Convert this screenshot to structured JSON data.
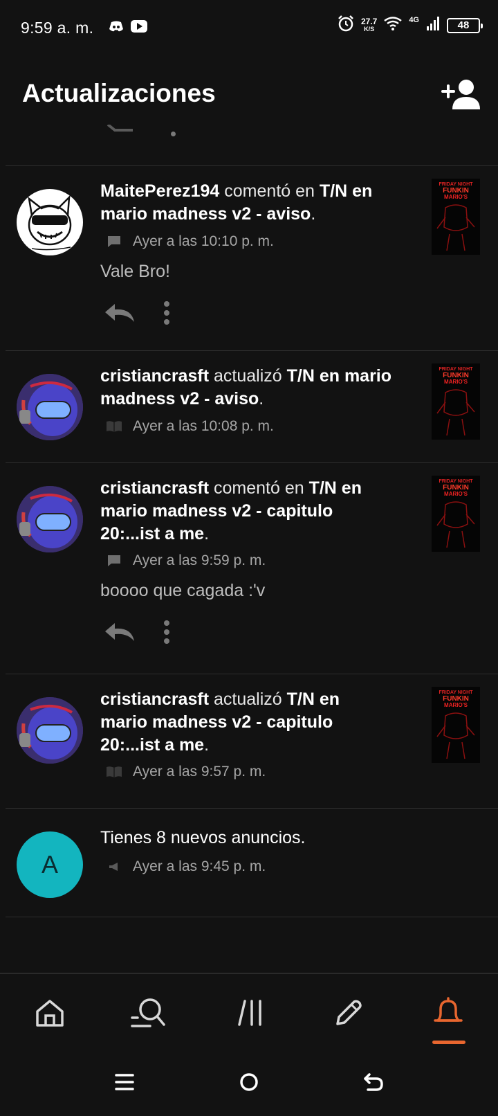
{
  "status_bar": {
    "time": "9:59 a. m.",
    "speed_value": "27.7",
    "speed_unit": "K/S",
    "network": "4G",
    "battery": "48"
  },
  "header": {
    "title": "Actualizaciones"
  },
  "notifications": [
    {
      "user": "MaitePerez194",
      "action": "comentó en",
      "story": "T/N en mario madness v2 - aviso",
      "suffix": ".",
      "timestamp": "Ayer a las 10:10 p. m.",
      "meta_icon": "comment-icon",
      "comment": "Vale Bro!"
    },
    {
      "user": "cristiancrasft",
      "action": "actualizó",
      "story": "T/N en mario madness v2 - aviso",
      "suffix": ".",
      "timestamp": "Ayer a las 10:08 p. m.",
      "meta_icon": "book-icon"
    },
    {
      "user": "cristiancrasft",
      "action": "comentó en",
      "story": "T/N en mario madness v2 - capitulo 20:...ist a me",
      "suffix": ".",
      "timestamp": "Ayer a las 9:59 p. m.",
      "meta_icon": "comment-icon",
      "comment": "boooo que cagada :'v"
    },
    {
      "user": "cristiancrasft",
      "action": "actualizó",
      "story": "T/N en mario madness v2 - capitulo 20:...ist a me",
      "suffix": ".",
      "timestamp": "Ayer a las 9:57 p. m.",
      "meta_icon": "book-icon"
    },
    {
      "message": "Tienes 8 nuevos anuncios.",
      "timestamp": "Ayer a las 9:45 p. m.",
      "meta_icon": "megaphone-icon",
      "avatar_letter": "A"
    }
  ],
  "thumbnail_text": "FRIDAY NIGHT FUNKIN MARIO'S MADNESS",
  "bottom_nav": [
    {
      "icon": "home-icon",
      "active": false
    },
    {
      "icon": "search-icon",
      "active": false
    },
    {
      "icon": "library-icon",
      "active": false
    },
    {
      "icon": "write-icon",
      "active": false
    },
    {
      "icon": "bell-icon",
      "active": true
    }
  ],
  "colors": {
    "background": "#121212",
    "accent": "#e8662f",
    "announcement_avatar": "#13b5bf",
    "secondary_text": "#a6a6a6"
  }
}
